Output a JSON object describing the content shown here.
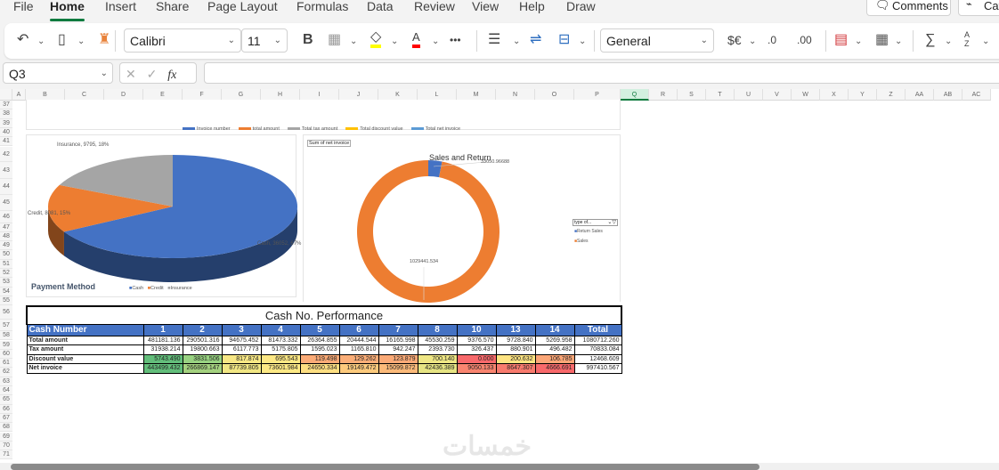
{
  "menu": {
    "tabs": [
      "File",
      "Home",
      "Insert",
      "Share",
      "Page Layout",
      "Formulas",
      "Data",
      "Review",
      "View",
      "Help",
      "Draw"
    ],
    "active": "Home",
    "comments": "Comments",
    "catchup": "Cat"
  },
  "toolbar": {
    "font": "Calibri",
    "size": "11",
    "bold": "B",
    "more": "•••",
    "number_format": "General",
    "currency": "$€",
    "inc_decimal": ".0",
    "dec_decimal": ".00",
    "sum": "∑",
    "sort": "A Z"
  },
  "formula_bar": {
    "name_box": "Q3",
    "fx": "fx",
    "value": ""
  },
  "columns": [
    "A",
    "B",
    "C",
    "D",
    "E",
    "F",
    "G",
    "H",
    "I",
    "J",
    "K",
    "L",
    "M",
    "N",
    "O",
    "P",
    "Q",
    "R",
    "S",
    "T",
    "U",
    "V",
    "W",
    "X",
    "Y",
    "Z",
    "AA",
    "AB",
    "AC"
  ],
  "selected_column": "Q",
  "rows": [
    "37",
    "38",
    "39",
    "40",
    "41",
    "42",
    "43",
    "44",
    "45",
    "46",
    "47",
    "48",
    "49",
    "50",
    "51",
    "52",
    "53",
    "54",
    "55",
    "56",
    "57",
    "58",
    "59",
    "60",
    "61",
    "62",
    "63",
    "64",
    "65",
    "66",
    "67",
    "68",
    "69",
    "70",
    "71"
  ],
  "line_chart_legend": [
    {
      "label": "Invoice number",
      "color": "#4472c4"
    },
    {
      "label": "total amount",
      "color": "#ed7d31"
    },
    {
      "label": "Total tax amount",
      "color": "#a5a5a5"
    },
    {
      "label": "Total discount value",
      "color": "#ffc000"
    },
    {
      "label": "Total net invoice",
      "color": "#5b9bd5"
    }
  ],
  "pie_chart": {
    "title": "Payment Method",
    "slices": [
      {
        "name": "Cash",
        "value": 36052,
        "pct": 67,
        "label": "Cash, 36052, 67%",
        "color": "#4472c4"
      },
      {
        "name": "Credit",
        "value": 8081,
        "pct": 15,
        "label": "Credit, 8081, 15%",
        "color": "#ed7d31"
      },
      {
        "name": "Insurance",
        "value": 9795,
        "pct": 18,
        "label": "Insurance, 9795, 18%",
        "color": "#a5a5a5"
      }
    ]
  },
  "donut_chart": {
    "field_button": "Sum of net invoice",
    "title": "Sales and Return",
    "filter": "type of...",
    "slices": [
      {
        "name": "Return Sales",
        "value": 33050.96688,
        "label": "33050.96688",
        "color": "#4472c4"
      },
      {
        "name": "Sales",
        "value": 1029441.534,
        "label": "1029441.534",
        "color": "#ed7d31"
      }
    ]
  },
  "table": {
    "title": "Cash No. Performance",
    "header_label": "Cash Number",
    "columns": [
      "1",
      "2",
      "3",
      "4",
      "5",
      "6",
      "7",
      "8",
      "10",
      "13",
      "14",
      "Total"
    ],
    "rows": [
      {
        "label": "Total amount",
        "values": [
          "481181.136",
          "290501.316",
          "94675.452",
          "81473.332",
          "26364.855",
          "20444.544",
          "16165.998",
          "45530.259",
          "9376.570",
          "9728.840",
          "5269.958",
          "1080712.260"
        ]
      },
      {
        "label": "Tax amount",
        "values": [
          "31938.214",
          "19800.663",
          "6117.773",
          "5175.805",
          "1595.023",
          "1165.810",
          "942.247",
          "2393.730",
          "326.437",
          "880.901",
          "496.482",
          "70833.084"
        ]
      },
      {
        "label": "Discount value",
        "values": [
          "5743.490",
          "3831.506",
          "817.874",
          "695.543",
          "119.498",
          "129.262",
          "123.879",
          "700.140",
          "0.000",
          "200.632",
          "106.785",
          "12468.609"
        ],
        "colors": [
          "#63be7b",
          "#98d281",
          "#f7e784",
          "#fde884",
          "#fbab77",
          "#fbae78",
          "#fbaa77",
          "#eee684",
          "#f8696b",
          "#fee482",
          "#fba677",
          ""
        ]
      },
      {
        "label": "Net invoice",
        "values": [
          "443499.432",
          "266869.147",
          "87739.805",
          "73601.984",
          "24650.334",
          "19149.472",
          "15099.872",
          "42436.389",
          "9050.133",
          "8647.307",
          "4666.691",
          "997410.567"
        ],
        "colors": [
          "#63be7b",
          "#a4d17f",
          "#f2e784",
          "#fde985",
          "#fedf82",
          "#fdca7d",
          "#fcba7a",
          "#e6e483",
          "#f98570",
          "#f87b6e",
          "#f8696b",
          ""
        ]
      }
    ]
  },
  "watermark": "خمسات"
}
